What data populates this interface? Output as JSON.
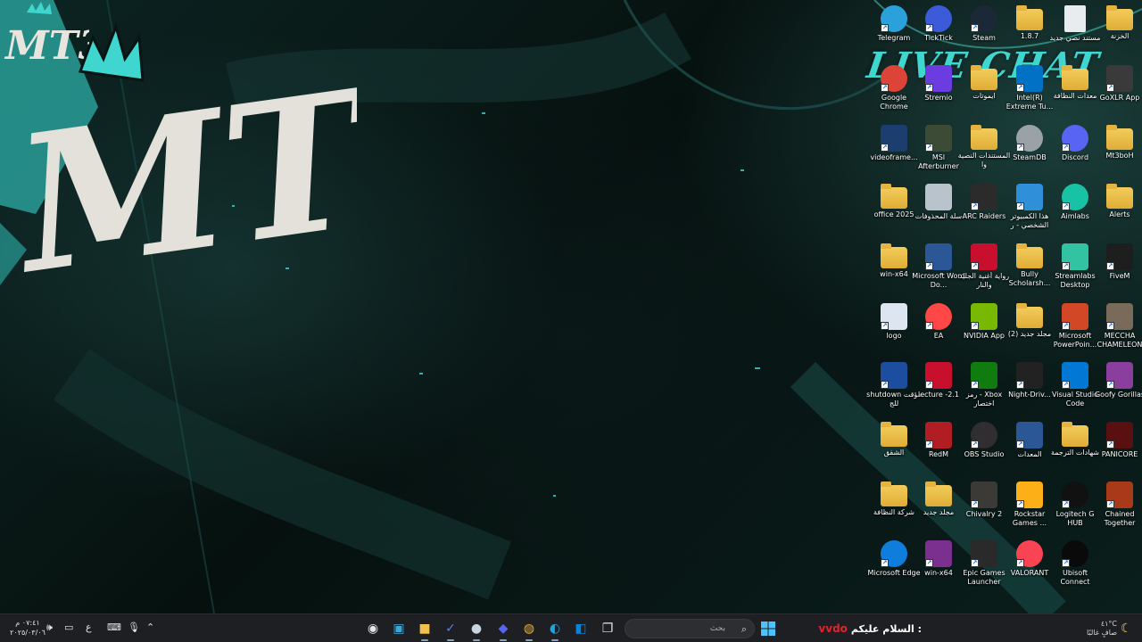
{
  "wallpaper": {
    "corner_logo_text": "MT3",
    "center_logo_text": "MT3",
    "overlay_text": "LIVE CHAT",
    "accent_color": "#3fd6cf"
  },
  "desktop": {
    "icons": [
      {
        "label": "Telegram",
        "icon": "telegram-icon",
        "color": "#2aa1db"
      },
      {
        "label": "TickTick",
        "icon": "ticktick-icon",
        "color": "#3c5bd8"
      },
      {
        "label": "Steam",
        "icon": "steam-icon",
        "color": "#1b2838"
      },
      {
        "label": "1.8.7",
        "icon": "folder-icon",
        "color": "#f2cc5c"
      },
      {
        "label": "مستند نصي جديد",
        "icon": "text-document-icon",
        "color": "#e9ecef"
      },
      {
        "label": "الخزنة",
        "icon": "folder-icon",
        "color": "#f2cc5c"
      },
      {
        "label": "Google Chrome",
        "icon": "chrome-icon",
        "color": "#db4437"
      },
      {
        "label": "Stremio",
        "icon": "stremio-icon",
        "color": "#6b3ce0"
      },
      {
        "label": "ايموتات",
        "icon": "folder-icon",
        "color": "#f2cc5c"
      },
      {
        "label": "Intel(R) Extreme Tu...",
        "icon": "intel-xtu-icon",
        "color": "#0071c5"
      },
      {
        "label": "معدات النظافة",
        "icon": "folder-icon",
        "color": "#f2cc5c"
      },
      {
        "label": "GoXLR App",
        "icon": "goxlr-icon",
        "color": "#3a3a3a"
      },
      {
        "label": "videoframe...",
        "icon": "videoframe-icon",
        "color": "#1c3e6e"
      },
      {
        "label": "MSI Afterburner",
        "icon": "msi-afterburner-icon",
        "color": "#3b4b35"
      },
      {
        "label": "المستندات النصية وا",
        "icon": "folder-icon",
        "color": "#f2cc5c"
      },
      {
        "label": "SteamDB",
        "icon": "steamdb-icon",
        "color": "#9aa2a8"
      },
      {
        "label": "Discord",
        "icon": "discord-icon",
        "color": "#5865f2"
      },
      {
        "label": "Mt3boH",
        "icon": "folder-icon",
        "color": "#f2cc5c"
      },
      {
        "label": "office 2025",
        "icon": "folder-icon",
        "color": "#f2cc5c"
      },
      {
        "label": "سلة المحذوفات",
        "icon": "recycle-bin-icon",
        "color": "#b9c3cc"
      },
      {
        "label": "ARC Raiders",
        "icon": "arc-raiders-icon",
        "color": "#2b2b2b"
      },
      {
        "label": "هذا الكمبيوتر الشخصي - ر",
        "icon": "this-pc-icon",
        "color": "#2f8fd8"
      },
      {
        "label": "Aimlabs",
        "icon": "aimlabs-icon",
        "color": "#17c3a4"
      },
      {
        "label": "Alerts",
        "icon": "folder-icon",
        "color": "#f2cc5c"
      },
      {
        "label": "win-x64",
        "icon": "folder-icon",
        "color": "#f2cc5c"
      },
      {
        "label": "Microsoft Word Do...",
        "icon": "word-document-icon",
        "color": "#2b5797"
      },
      {
        "label": "رواية أغنية الجليد والنار",
        "icon": "pdf-icon",
        "color": "#c8102e"
      },
      {
        "label": "Bully Scholarsh...",
        "icon": "folder-icon",
        "color": "#f2cc5c"
      },
      {
        "label": "Streamlabs Desktop",
        "icon": "streamlabs-icon",
        "color": "#31c3a2"
      },
      {
        "label": "FiveM",
        "icon": "fivem-icon",
        "color": "#1e1e1e"
      },
      {
        "label": "logo",
        "icon": "image-file-icon",
        "color": "#dde6f0"
      },
      {
        "label": "EA",
        "icon": "ea-icon",
        "color": "#ff4747"
      },
      {
        "label": "NVIDIA App",
        "icon": "nvidia-icon",
        "color": "#76b900"
      },
      {
        "label": "مجلد جديد (2)",
        "icon": "folder-icon",
        "color": "#f2cc5c"
      },
      {
        "label": "Microsoft PowerPoin...",
        "icon": "powerpoint-icon",
        "color": "#d24726"
      },
      {
        "label": "MECCHA CHAMELEON",
        "icon": "meccha-chameleon-icon",
        "color": "#7a6a5a"
      },
      {
        "label": "shutdown مؤقت للج",
        "icon": "shutdown-timer-icon",
        "color": "#1d4d9e"
      },
      {
        "label": "lecture -2.1",
        "icon": "pdf-icon",
        "color": "#c8102e"
      },
      {
        "label": "رمز - Xbox اختصار",
        "icon": "xbox-icon",
        "color": "#107c10"
      },
      {
        "label": "Night-Driv...",
        "icon": "night-drive-icon",
        "color": "#222222"
      },
      {
        "label": "Visual Studio Code",
        "icon": "vscode-icon",
        "color": "#0078d4"
      },
      {
        "label": "Goofy Gorillas",
        "icon": "goofy-gorillas-icon",
        "color": "#8a3f9e"
      },
      {
        "label": "الشقق",
        "icon": "folder-icon",
        "color": "#f2cc5c"
      },
      {
        "label": "RedM",
        "icon": "redm-icon",
        "color": "#b01e23"
      },
      {
        "label": "OBS Studio",
        "icon": "obs-icon",
        "color": "#302e31"
      },
      {
        "label": "المعدات",
        "icon": "word-document-icon",
        "color": "#2b5797"
      },
      {
        "label": "شهادات الترجمة",
        "icon": "folder-icon",
        "color": "#f2cc5c"
      },
      {
        "label": "PANICORE",
        "icon": "panicore-icon",
        "color": "#5a1010"
      },
      {
        "label": "شركة النظافة",
        "icon": "folder-icon",
        "color": "#f2cc5c"
      },
      {
        "label": "مجلد جديد",
        "icon": "folder-icon",
        "color": "#f2cc5c"
      },
      {
        "label": "Chivalry 2",
        "icon": "chivalry-2-icon",
        "color": "#3c3a36"
      },
      {
        "label": "Rockstar Games ...",
        "icon": "rockstar-icon",
        "color": "#fcaf17"
      },
      {
        "label": "Logitech G HUB",
        "icon": "logitech-ghub-icon",
        "color": "#111111"
      },
      {
        "label": "Chained Together",
        "icon": "chained-together-icon",
        "color": "#a83a1a"
      },
      {
        "label": "Microsoft Edge",
        "icon": "edge-icon",
        "color": "#0f7ddc"
      },
      {
        "label": "win-x64",
        "icon": "winrar-icon",
        "color": "#7b2f8f"
      },
      {
        "label": "Epic Games Launcher",
        "icon": "epic-games-icon",
        "color": "#2a2a2a"
      },
      {
        "label": "VALORANT",
        "icon": "valorant-icon",
        "color": "#fa4454"
      },
      {
        "label": "Ubisoft Connect",
        "icon": "ubisoft-icon",
        "color": "#0a0a0a"
      }
    ]
  },
  "taskbar": {
    "search_placeholder": "بحث",
    "chat_message": "السلام عليكم :",
    "chat_user": "vvdo",
    "chat_user_color": "#e0242f",
    "weather_temp": "٤١°C",
    "weather_desc": "صافٍ غالبًا",
    "clock_time": "٠٧:٤١ م",
    "clock_date": "٢٠٢٥/٠٣/٠٦",
    "language": "ع",
    "pinned": [
      {
        "name": "obs-taskbar-icon",
        "glyph": "◉",
        "color": "#e6e6e6"
      },
      {
        "name": "terminal-taskbar-icon",
        "glyph": "▣",
        "color": "#3aa7d8"
      },
      {
        "name": "file-explorer-taskbar-icon",
        "glyph": "■",
        "color": "#f2c14e"
      },
      {
        "name": "ticktick-taskbar-icon",
        "glyph": "✓",
        "color": "#5a7cf0"
      },
      {
        "name": "steam-taskbar-icon",
        "glyph": "●",
        "color": "#c7d5e0"
      },
      {
        "name": "discord-taskbar-icon",
        "glyph": "◆",
        "color": "#5865f2"
      },
      {
        "name": "chrome-taskbar-icon",
        "glyph": "◍",
        "color": "#e8b33a"
      },
      {
        "name": "edge-taskbar-icon",
        "glyph": "◐",
        "color": "#1fa3e0"
      },
      {
        "name": "vscode-taskbar-icon",
        "glyph": "◧",
        "color": "#0a84d8"
      },
      {
        "name": "task-view-taskbar-icon",
        "glyph": "❐",
        "color": "#e6e6e6"
      }
    ]
  }
}
